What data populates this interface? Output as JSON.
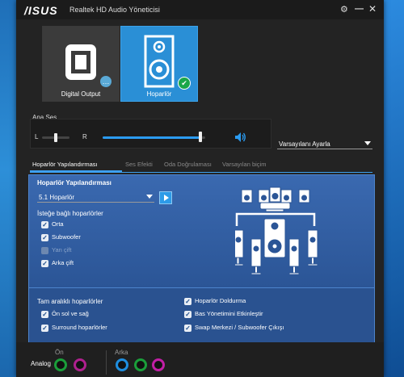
{
  "window": {
    "logo": "/ISUS",
    "title": "Realtek HD Audio Yöneticisi"
  },
  "devices": [
    {
      "label": "Digital Output"
    },
    {
      "label": "Hoparlör"
    }
  ],
  "volume": {
    "label": "Ana Ses",
    "left": "L",
    "right": "R",
    "balance": 0.5,
    "level": 0.95
  },
  "defaults_select": {
    "value": "Varsayılanı Ayarla"
  },
  "tabs": [
    "Hoparlör Yapılandırması",
    "Ses Efekti",
    "Oda Doğrulaması",
    "Varsayılan biçim"
  ],
  "config": {
    "title": "Hoparlör Yapılandırması",
    "mode": "5.1 Hoparlör",
    "optional_title": "İsteğe bağlı hoparlörler",
    "optional": [
      {
        "label": "Orta",
        "checked": true,
        "enabled": true
      },
      {
        "label": "Subwoofer",
        "checked": true,
        "enabled": true
      },
      {
        "label": "Yan çift",
        "checked": true,
        "enabled": false
      },
      {
        "label": "Arka çift",
        "checked": true,
        "enabled": true
      }
    ]
  },
  "fullrange": {
    "title": "Tam aralıklı hoparlörler",
    "items": [
      {
        "label": "Ön sol ve sağ",
        "checked": true
      },
      {
        "label": "Surround hoparlörler",
        "checked": true
      }
    ],
    "right_items": [
      {
        "label": "Hoparlör Doldurma"
      },
      {
        "label": "Bas Yönetimini Etkinleştir"
      },
      {
        "label": "Swap Merkezi / Subwoofer Çıkışı"
      }
    ]
  },
  "analog": {
    "label": "Analog",
    "front_label": "Ön",
    "rear_label": "Arka",
    "front_jacks": [
      "#1a9e3a",
      "#b0208f"
    ],
    "rear_jacks": [
      "#1e8ee0",
      "#1a9e3a",
      "#c21fa6"
    ]
  }
}
